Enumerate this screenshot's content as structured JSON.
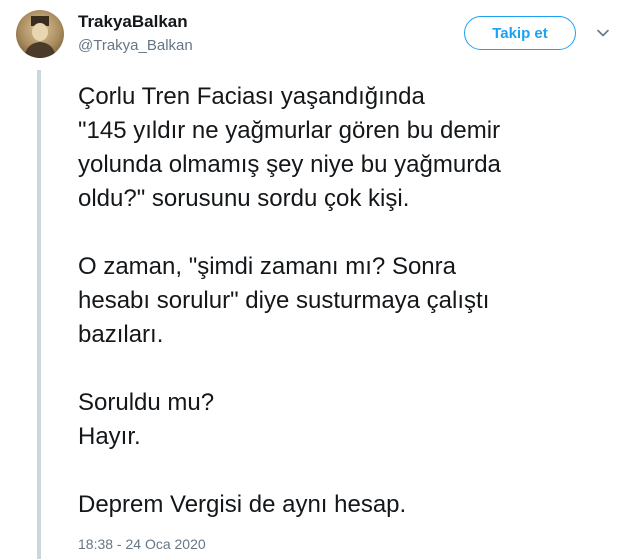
{
  "user": {
    "name": "TrakyaBalkan",
    "handle": "@Trakya_Balkan",
    "avatar_icon": "portrait-avatar"
  },
  "actions": {
    "follow_label": "Takip et",
    "more_icon": "chevron-down-icon"
  },
  "tweet": {
    "paragraphs": [
      [
        "Çorlu Tren Faciası yaşandığında",
        "\"145 yıldır ne yağmurlar gören bu demir",
        "yolunda olmamış şey niye bu yağmurda",
        "oldu?\" sorusunu sordu çok kişi."
      ],
      [
        "O zaman, \"şimdi zamanı mı? Sonra",
        "hesabı sorulur\" diye susturmaya çalıştı",
        "bazıları."
      ],
      [
        "Soruldu mu?",
        "Hayır."
      ],
      [
        "Deprem Vergisi de aynı hesap."
      ]
    ],
    "timestamp": "18:38 - 24 Oca 2020"
  },
  "colors": {
    "accent": "#1da1f2",
    "text": "#14171a",
    "muted": "#657786",
    "thread_line": "#ccd6dd"
  }
}
